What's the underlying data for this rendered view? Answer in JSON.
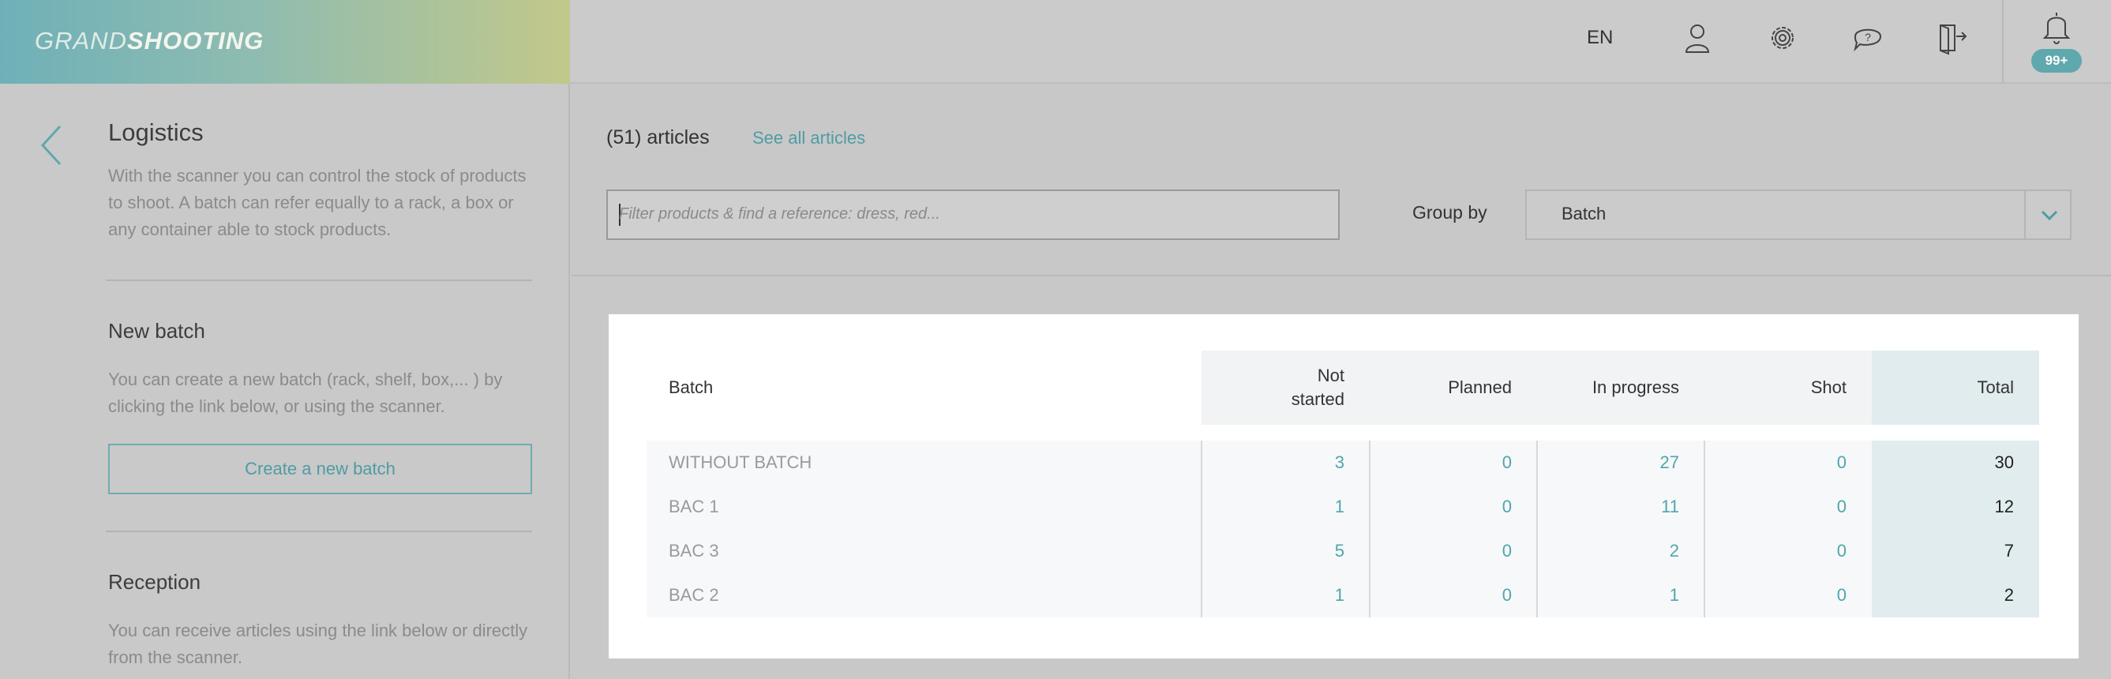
{
  "header": {
    "logo_light": "GRAND",
    "logo_bold": "SHOOTING",
    "language": "EN",
    "notification_count": "99+"
  },
  "sidebar": {
    "title": "Logistics",
    "description": "With the scanner you can control the stock of products to shoot. A batch can refer equally to a rack, a box or any container able to stock products.",
    "new_batch": {
      "heading": "New batch",
      "text": "You can create a new batch (rack, shelf, box,... ) by clicking the link below, or using the scanner.",
      "button": "Create a new batch"
    },
    "reception": {
      "heading": "Reception",
      "text": "You can receive articles using the link below or directly from the scanner."
    }
  },
  "main": {
    "articles_count": "(51) articles",
    "see_all": "See all articles",
    "filter_placeholder": "Filter products & find a reference: dress, red...",
    "group_by_label": "Group by",
    "group_by_value": "Batch"
  },
  "table": {
    "headers": {
      "batch": "Batch",
      "not_started_1": "Not",
      "not_started_2": "started",
      "planned": "Planned",
      "in_progress": "In progress",
      "shot": "Shot",
      "total": "Total"
    },
    "rows": [
      {
        "batch": "WITHOUT BATCH",
        "not_started": "3",
        "planned": "0",
        "in_progress": "27",
        "shot": "0",
        "total": "30"
      },
      {
        "batch": "BAC 1",
        "not_started": "1",
        "planned": "0",
        "in_progress": "11",
        "shot": "0",
        "total": "12"
      },
      {
        "batch": "BAC 3",
        "not_started": "5",
        "planned": "0",
        "in_progress": "2",
        "shot": "0",
        "total": "7"
      },
      {
        "batch": "BAC 2",
        "not_started": "1",
        "planned": "0",
        "in_progress": "1",
        "shot": "0",
        "total": "2"
      }
    ]
  },
  "colors": {
    "accent": "#4f9ca3",
    "badge": "#5fa8ae"
  },
  "icons": [
    "user-icon",
    "settings-icon",
    "help-icon",
    "logout-icon",
    "bell-icon",
    "back-arrow-icon",
    "chevron-down-icon"
  ]
}
